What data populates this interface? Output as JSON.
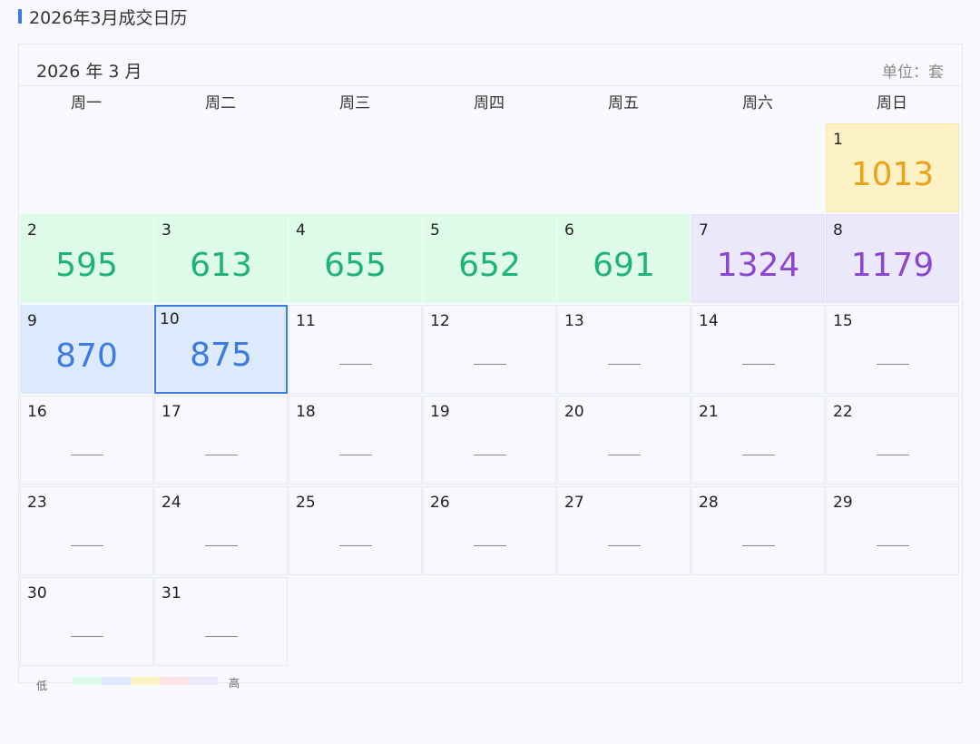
{
  "page": {
    "title": "2026年3月成交日历"
  },
  "calendar": {
    "month_label": "2026 年 3 月",
    "unit_label": "单位：套",
    "weekdays": [
      "周一",
      "周二",
      "周三",
      "周四",
      "周五",
      "周六",
      "周日"
    ],
    "first_weekday_index": 6,
    "selected_day": 10,
    "empty_placeholder_icon": "dash-line",
    "days": [
      {
        "day": "1",
        "value": "1013",
        "level": "yellow"
      },
      {
        "day": "2",
        "value": "595",
        "level": "green"
      },
      {
        "day": "3",
        "value": "613",
        "level": "green"
      },
      {
        "day": "4",
        "value": "655",
        "level": "green"
      },
      {
        "day": "5",
        "value": "652",
        "level": "green"
      },
      {
        "day": "6",
        "value": "691",
        "level": "green"
      },
      {
        "day": "7",
        "value": "1324",
        "level": "purple"
      },
      {
        "day": "8",
        "value": "1179",
        "level": "purple"
      },
      {
        "day": "9",
        "value": "870",
        "level": "blue"
      },
      {
        "day": "10",
        "value": "875",
        "level": "blue"
      },
      {
        "day": "11",
        "value": null,
        "level": "none"
      },
      {
        "day": "12",
        "value": null,
        "level": "none"
      },
      {
        "day": "13",
        "value": null,
        "level": "none"
      },
      {
        "day": "14",
        "value": null,
        "level": "none"
      },
      {
        "day": "15",
        "value": null,
        "level": "none"
      },
      {
        "day": "16",
        "value": null,
        "level": "none"
      },
      {
        "day": "17",
        "value": null,
        "level": "none"
      },
      {
        "day": "18",
        "value": null,
        "level": "none"
      },
      {
        "day": "19",
        "value": null,
        "level": "none"
      },
      {
        "day": "20",
        "value": null,
        "level": "none"
      },
      {
        "day": "21",
        "value": null,
        "level": "none"
      },
      {
        "day": "22",
        "value": null,
        "level": "none"
      },
      {
        "day": "23",
        "value": null,
        "level": "none"
      },
      {
        "day": "24",
        "value": null,
        "level": "none"
      },
      {
        "day": "25",
        "value": null,
        "level": "none"
      },
      {
        "day": "26",
        "value": null,
        "level": "none"
      },
      {
        "day": "27",
        "value": null,
        "level": "none"
      },
      {
        "day": "28",
        "value": null,
        "level": "none"
      },
      {
        "day": "29",
        "value": null,
        "level": "none"
      },
      {
        "day": "30",
        "value": null,
        "level": "none"
      },
      {
        "day": "31",
        "value": null,
        "level": "none"
      }
    ]
  },
  "legend": {
    "low_label": "低",
    "high_label": "高",
    "colors": [
      "#ddfbe6",
      "#dde9fc",
      "#fdf2c6",
      "#fde3e6",
      "#ece8fc"
    ]
  }
}
